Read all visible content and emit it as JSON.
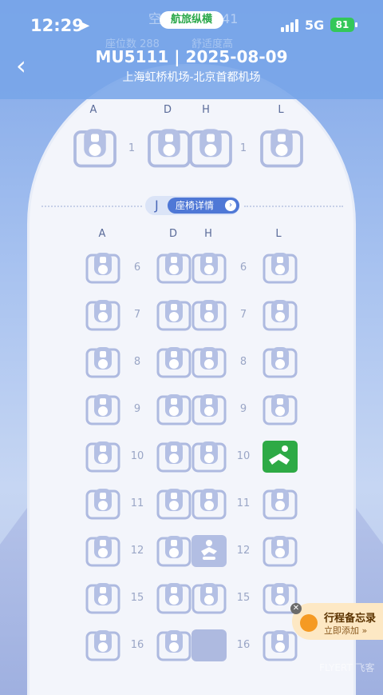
{
  "status": {
    "time": "12:29",
    "network": "5G",
    "battery": "81"
  },
  "app_badge": "航旅纵横",
  "faded_header": {
    "line1": "空",
    "line1b": "41",
    "seat_count": "座位数 288",
    "comfort": "舒适度高"
  },
  "flight": {
    "title": "MU5111 | 2025-08-09",
    "route": "上海虹桥机场-北京首都机场"
  },
  "first_class": {
    "columns": [
      "A",
      "D",
      "H",
      "L"
    ],
    "row": "1"
  },
  "section": {
    "letter": "J",
    "detail_label": "座椅详情"
  },
  "business": {
    "columns": [
      "A",
      "D",
      "H",
      "L"
    ],
    "rows": [
      "6",
      "7",
      "8",
      "9",
      "10",
      "11",
      "12",
      "15",
      "16"
    ]
  },
  "memo": {
    "title": "行程备忘录",
    "subtitle": "立即添加 »"
  },
  "watermark": "FLYERT 飞客",
  "colors": {
    "selected": "#2eaa45",
    "accent": "#4f78d6",
    "seat": "#b2bee3"
  }
}
